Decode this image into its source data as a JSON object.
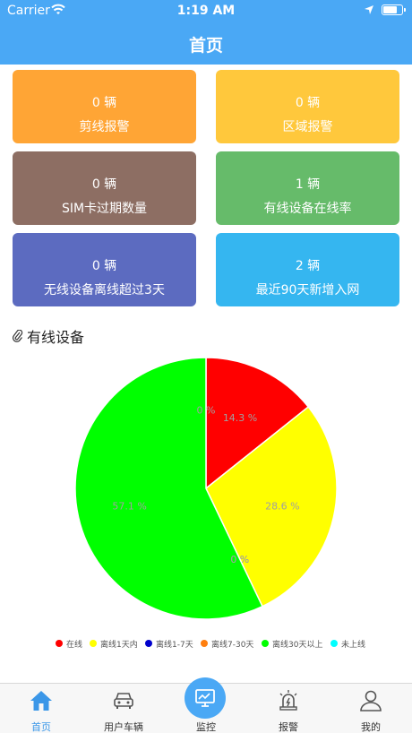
{
  "status_bar": {
    "carrier": "Carrier",
    "time": "1:19 AM"
  },
  "header": {
    "title": "首页"
  },
  "cards": [
    {
      "value": "0 辆",
      "label": "剪线报警",
      "color": "#ffa535"
    },
    {
      "value": "0 辆",
      "label": "区域报警",
      "color": "#ffc83c"
    },
    {
      "value": "0 辆",
      "label": "SIM卡过期数量",
      "color": "#8d6e63"
    },
    {
      "value": "1 辆",
      "label": "有线设备在线率",
      "color": "#66bb6a"
    },
    {
      "value": "0 辆",
      "label": "无线设备离线超过3天",
      "color": "#5c6bc0"
    },
    {
      "value": "2 辆",
      "label": "最近90天新增入网",
      "color": "#35b6f0"
    }
  ],
  "section": {
    "title": "有线设备"
  },
  "chart_data": {
    "type": "pie",
    "slices": [
      {
        "name": "在线",
        "value": 14.3,
        "label": "14.3 %",
        "color": "#ff0000"
      },
      {
        "name": "离线1天内",
        "value": 28.6,
        "label": "28.6 %",
        "color": "#ffff00"
      },
      {
        "name": "离线1-7天",
        "value": 0,
        "label": "0 %",
        "color": "#0000cc"
      },
      {
        "name": "离线7-30天",
        "value": 0,
        "label": "0 %",
        "color": "#ff7f0e"
      },
      {
        "name": "离线30天以上",
        "value": 57.1,
        "label": "57.1 %",
        "color": "#00ff00"
      },
      {
        "name": "未上线",
        "value": 0,
        "label": "0 %",
        "color": "#00ffff"
      }
    ],
    "legend_position": "bottom"
  },
  "legend_visible": [
    "在线",
    "离线1天内",
    "离线1-7天",
    "离线7-30天",
    "离线30天以上",
    "未上线"
  ],
  "tabbar": {
    "items": [
      {
        "label": "首页",
        "icon": "home-icon"
      },
      {
        "label": "用户车辆",
        "icon": "car-icon"
      },
      {
        "label": "监控",
        "icon": "monitor-icon"
      },
      {
        "label": "报警",
        "icon": "alarm-icon"
      },
      {
        "label": "我的",
        "icon": "user-icon"
      }
    ],
    "active_color": "#3b97e8"
  }
}
